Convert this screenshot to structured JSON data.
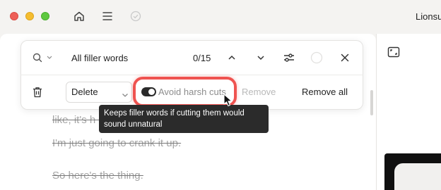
{
  "window": {
    "title": "Lionsu"
  },
  "toolbar": {
    "icons": [
      "home-icon",
      "menu-icon",
      "check-circle-icon"
    ]
  },
  "find_panel": {
    "query": "All filler words",
    "match_count": "0/15",
    "action_select": {
      "selected": "Delete"
    },
    "avoid_harsh_cuts": {
      "label": "Avoid harsh cuts",
      "enabled": true
    },
    "remove_label": "Remove",
    "remove_all_label": "Remove all"
  },
  "tooltip": {
    "line1": "Keeps filler words if cutting them would",
    "line2": "sound unnatural"
  },
  "transcript": {
    "line1": "like, it's h                                              e things. So",
    "line2": "I'm just going to crank it up.",
    "line3": "So here's the thing."
  },
  "colors": {
    "highlight": "#ef5350",
    "tooltip_bg": "#2b2b2b",
    "struck_text": "#a5a5a5"
  }
}
